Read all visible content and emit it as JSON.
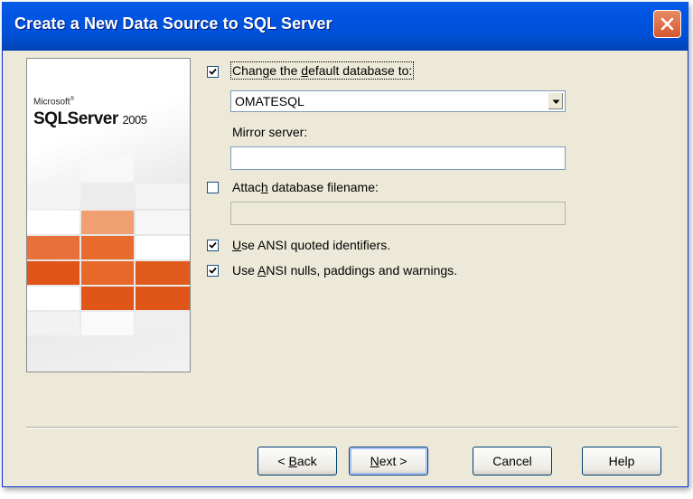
{
  "window": {
    "title": "Create a New Data Source to SQL Server"
  },
  "banner": {
    "brand_small": "Microsoft",
    "brand_product": "SQLServer",
    "brand_year": "2005"
  },
  "options": {
    "change_default_db": {
      "checked": true,
      "label_pre": "Change the ",
      "label_mnemonic": "d",
      "label_post": "efault database to:"
    },
    "database_combo": {
      "value": "OMATESQL"
    },
    "mirror_server": {
      "label": "Mirror server:",
      "value": ""
    },
    "attach_db": {
      "checked": false,
      "label_pre": "Attac",
      "label_mnemonic": "h",
      "label_post": " database filename:",
      "value": ""
    },
    "ansi_quoted": {
      "checked": true,
      "label_pre": "",
      "label_mnemonic": "U",
      "label_post": "se ANSI quoted identifiers."
    },
    "ansi_nulls": {
      "checked": true,
      "label_pre": "Use ",
      "label_mnemonic": "A",
      "label_post": "NSI nulls, paddings and warnings."
    }
  },
  "buttons": {
    "back": {
      "pre": "< ",
      "mnemonic": "B",
      "post": "ack"
    },
    "next": {
      "pre": "",
      "mnemonic": "N",
      "post": "ext >"
    },
    "cancel": "Cancel",
    "help": "Help"
  },
  "colors": {
    "titlebar": "#0054e3",
    "close_button": "#d4582f",
    "dialog_bg": "#ece9d8",
    "accent_orange": "#e06020",
    "accent_orange_light": "#f0a070"
  },
  "icons": {
    "close": "close-icon",
    "checkmark": "checkmark-icon",
    "dropdown": "chevron-down-icon"
  }
}
